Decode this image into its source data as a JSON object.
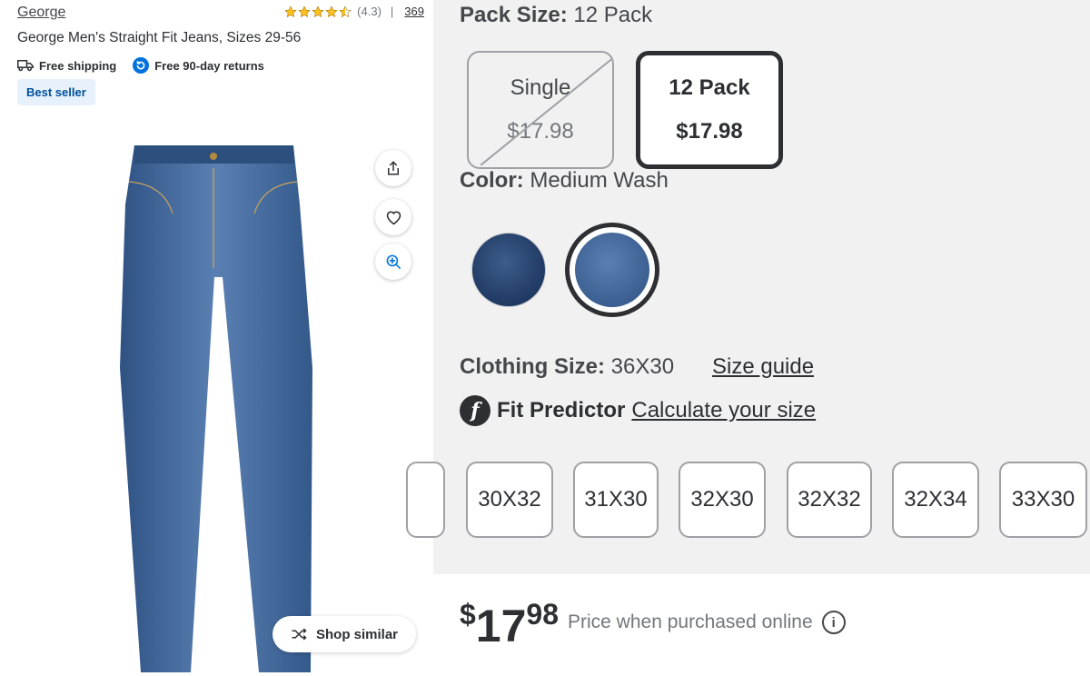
{
  "product": {
    "brand": "George",
    "rating_text": "(4.3)",
    "rating_value": 4.3,
    "separator": "|",
    "review_count": "369",
    "title": "George Men's Straight Fit Jeans, Sizes 29-56",
    "benefits": [
      "Free shipping",
      "Free 90-day returns"
    ],
    "badge": "Best seller"
  },
  "actions": {
    "shop_similar": "Shop similar"
  },
  "pack": {
    "label": "Pack Size:",
    "selected": "12 Pack",
    "options": [
      {
        "name": "Single",
        "price": "$17.98",
        "available": false
      },
      {
        "name": "12 Pack",
        "price": "$17.98",
        "available": true
      }
    ]
  },
  "color": {
    "label": "Color:",
    "selected": "Medium Wash",
    "swatch_colors": [
      "#2b4a78",
      "#4b6fa2"
    ]
  },
  "clothing_size": {
    "label": "Clothing Size:",
    "selected": "36X30",
    "size_guide": "Size guide",
    "sizes": [
      "30X32",
      "31X30",
      "32X30",
      "32X32",
      "32X34",
      "33X30"
    ]
  },
  "fit_predictor": {
    "logo": "f",
    "title": "Fit Predictor",
    "link": "Calculate your size"
  },
  "price": {
    "currency": "$",
    "dollars": "17",
    "cents": "98",
    "note": "Price when purchased online",
    "info": "i"
  },
  "colors": {
    "star": "#ffc220",
    "badge_bg": "#e6f1fc",
    "badge_text": "#004f9a",
    "returns_icon": "#0071dc",
    "selected_border": "#2e2f32"
  }
}
